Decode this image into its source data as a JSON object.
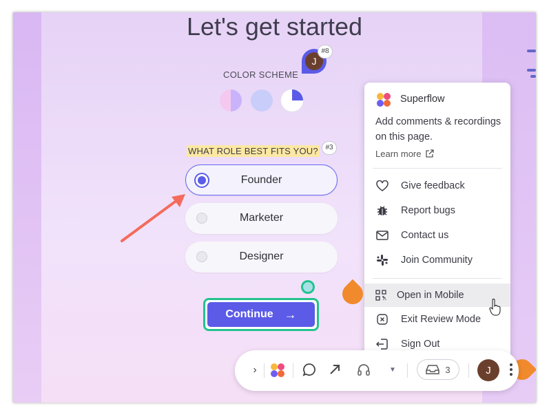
{
  "page": {
    "title": "Let's get started",
    "color_scheme_label": "COLOR SCHEME",
    "role_question": "WHAT ROLE BEST FITS YOU?",
    "options": [
      "Founder",
      "Marketer",
      "Designer"
    ],
    "selected_option": "Founder",
    "continue_label": "Continue",
    "continue_arrow": "→"
  },
  "comments": {
    "pin_badge": "#8",
    "pin_avatar": "J",
    "role_badge": "#3"
  },
  "menu": {
    "app_name": "Superflow",
    "description": "Add comments & recordings on this page.",
    "learn_more": "Learn more",
    "items": [
      {
        "label": "Give feedback",
        "icon": "heart-icon"
      },
      {
        "label": "Report bugs",
        "icon": "bug-icon"
      },
      {
        "label": "Contact us",
        "icon": "mail-icon"
      },
      {
        "label": "Join Community",
        "icon": "slack-icon"
      },
      {
        "label": "Open in Mobile",
        "icon": "qr-code-icon"
      },
      {
        "label": "Exit Review Mode",
        "icon": "close-square-icon"
      },
      {
        "label": "Sign Out",
        "icon": "sign-out-icon"
      }
    ]
  },
  "toolbar": {
    "inbox_count": "3",
    "avatar_initial": "J"
  },
  "colors": {
    "accent": "#5b5be8",
    "continue_border": "#22c38e",
    "annotation_orange": "#f08a2c",
    "annotation_arrow": "#f46b5b",
    "highlight": "#fde8a3"
  }
}
